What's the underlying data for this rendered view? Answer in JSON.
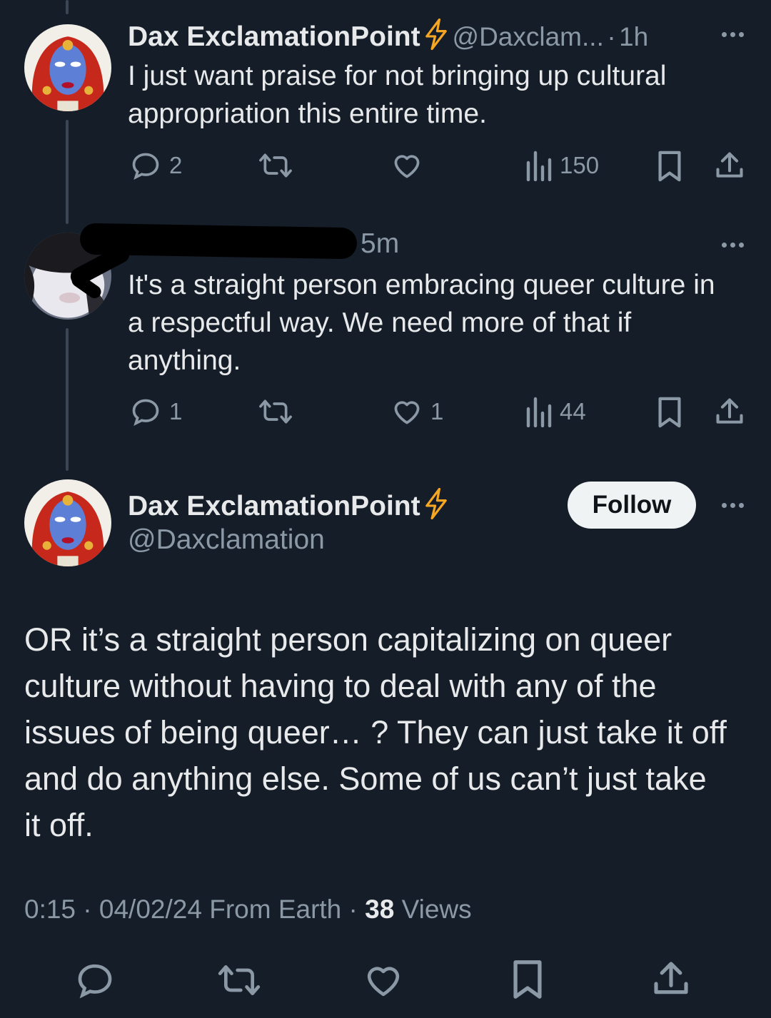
{
  "tweet1": {
    "display_name": "Dax ExclamationPoint",
    "handle": "@Daxclam...",
    "separator": "·",
    "time": "1h",
    "text": "I just want praise for not bringing up cultural appropriation this entire time.",
    "replies": "2",
    "views": "150"
  },
  "tweet2": {
    "time": "5m",
    "text": "It's a straight person embracing queer culture in a respectful way. We need more of that if anything.",
    "replies": "1",
    "likes": "1",
    "views": "44"
  },
  "main_tweet": {
    "display_name": "Dax ExclamationPoint",
    "handle": "@Daxclamation",
    "follow_label": "Follow",
    "text": "OR it’s a straight person capitalizing on queer culture without having to deal with any of the issues of being queer… ? They can just take it off and do anything else. Some of us can’t just take it off.",
    "time": "0:15",
    "date": "04/02/24",
    "source": "From Earth",
    "views_count": "38",
    "views_label": "Views",
    "sep": "·"
  },
  "icons": {
    "verified": "lightning-bolt-icon",
    "reply": "speech-bubble-icon",
    "retweet": "retweet-arrows-icon",
    "like": "heart-icon",
    "views": "bar-chart-icon",
    "bookmark": "bookmark-icon",
    "share": "share-upload-icon",
    "more": "ellipsis-icon"
  },
  "colors": {
    "background": "#151d28",
    "text": "#e7e9ea",
    "muted": "#8b98a5",
    "bolt": "#f5a623"
  }
}
